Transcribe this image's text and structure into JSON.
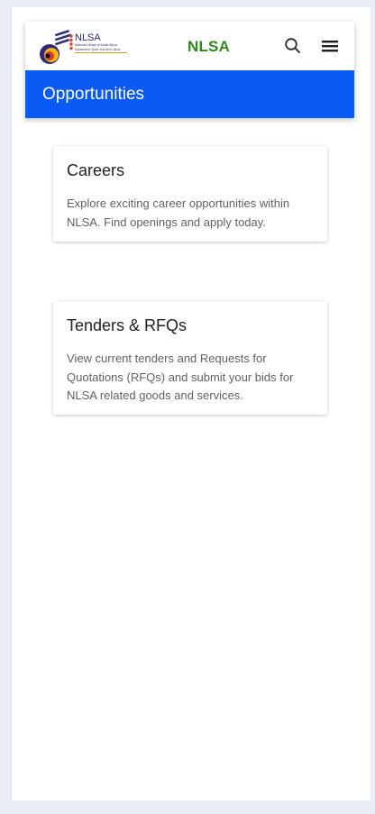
{
  "header": {
    "logo_text": "NLSA",
    "logo_subtext": "National Library of South Africa",
    "logo_tagline": "Department: Sport, Arts and Culture",
    "brand_title": "NLSA",
    "search_icon": "search-icon",
    "menu_icon": "hamburger-menu-icon",
    "brand_color": "#2f8a1c"
  },
  "page": {
    "title": "Opportunities",
    "header_color": "#0a5af5"
  },
  "cards": [
    {
      "title": "Careers",
      "description": "Explore exciting career opportunities within NLSA. Find openings and apply today."
    },
    {
      "title": "Tenders & RFQs",
      "description": "View current tenders and Requests for Quotations (RFQs) and submit your bids for NLSA related goods and services."
    }
  ]
}
